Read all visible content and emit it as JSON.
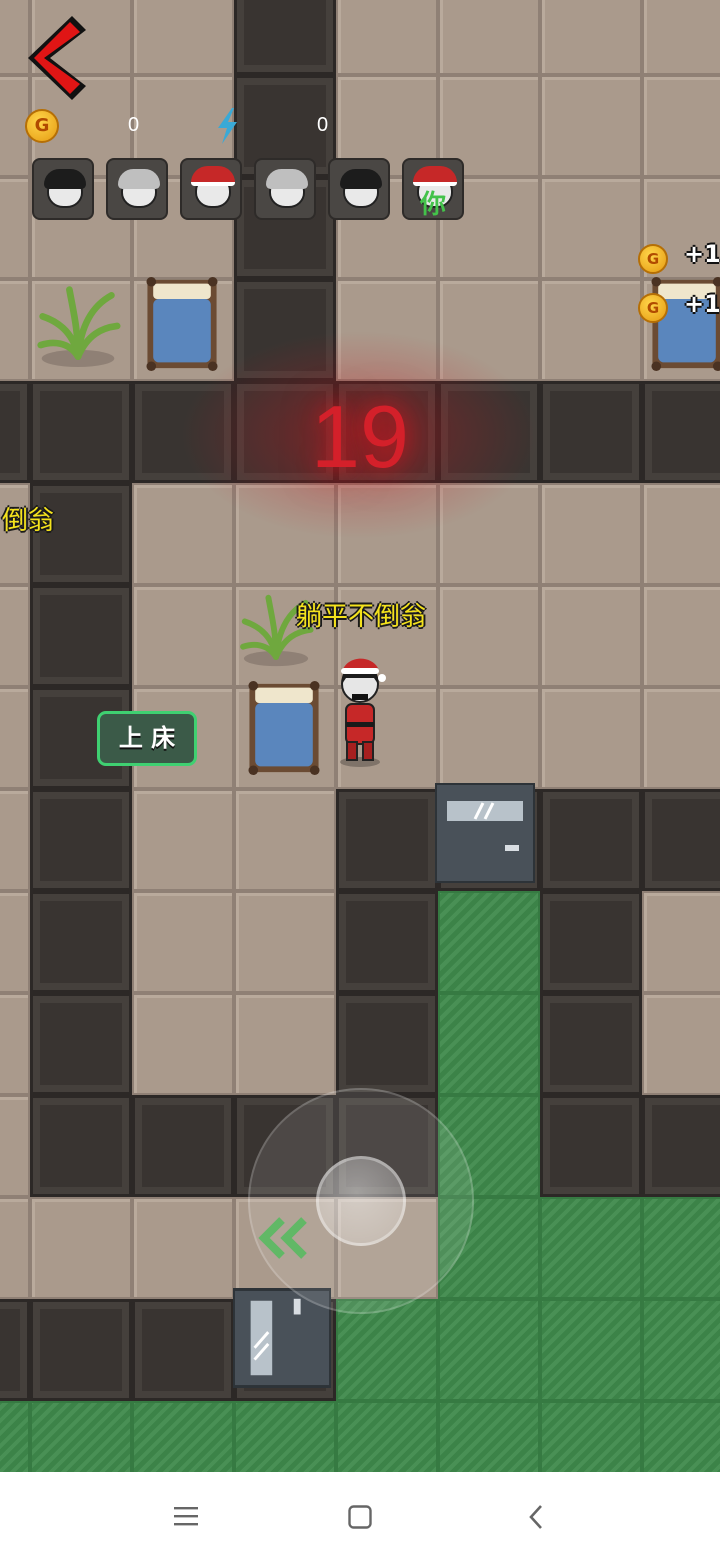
{
  "hud": {
    "coins": "0",
    "energy": "0",
    "coin_icon_letter": "G",
    "avatars": [
      {
        "type": "dark-hair"
      },
      {
        "type": "grey-hair"
      },
      {
        "type": "santa-hat"
      },
      {
        "type": "grey-hair"
      },
      {
        "type": "dark-hair"
      },
      {
        "type": "santa-hat-you",
        "label": "你"
      }
    ]
  },
  "timer": "19",
  "player_name": "躺平不倒翁",
  "offscreen_name": "倒翁",
  "bed_button_label": "上 床",
  "coin_gains": [
    "+1",
    "+1"
  ],
  "colors": {
    "accent_green": "#3fd071",
    "timer_red": "#d4202a",
    "name_yellow": "#f4e21c"
  }
}
